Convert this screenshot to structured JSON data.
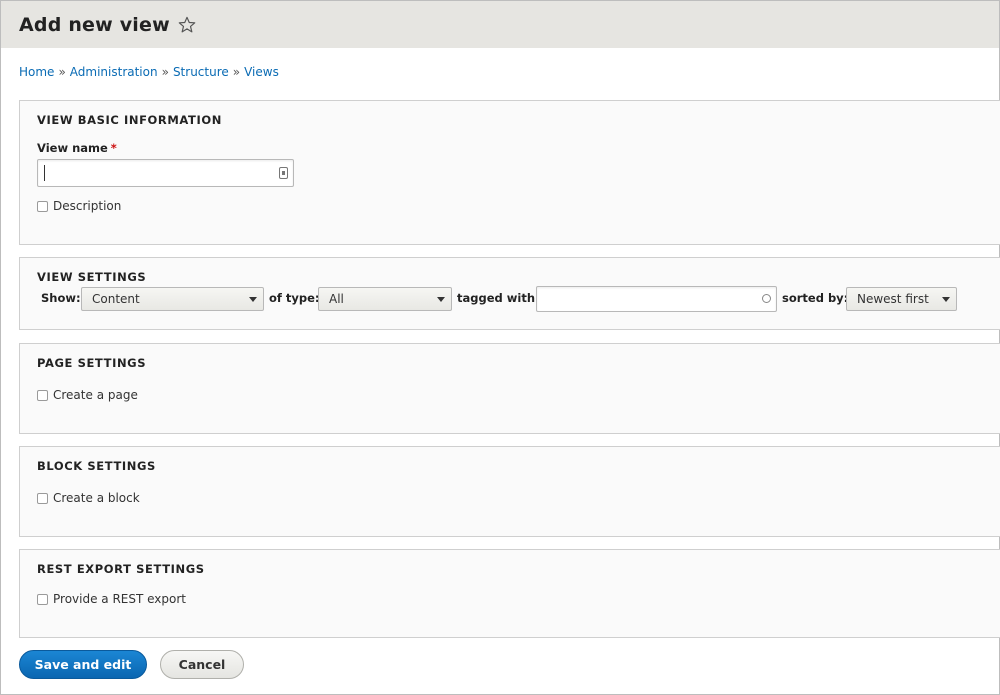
{
  "header": {
    "title": "Add new view",
    "favorite_icon": "star-outline-icon"
  },
  "breadcrumb": [
    "Home",
    "Administration",
    "Structure",
    "Views"
  ],
  "breadcrumb_separator": "»",
  "basic_info": {
    "legend": "VIEW BASIC INFORMATION",
    "view_name_label": "View name",
    "required_marker": "*",
    "view_name_value": "",
    "description_label": "Description"
  },
  "view_settings": {
    "legend": "VIEW SETTINGS",
    "show_label": "Show:",
    "show_value": "Content",
    "of_type_label": "of type:",
    "of_type_value": "All",
    "tagged_with_label": "tagged with:",
    "tagged_with_value": "",
    "sorted_by_label": "sorted by:",
    "sorted_by_value": "Newest first"
  },
  "page_settings": {
    "legend": "PAGE SETTINGS",
    "checkbox_label": "Create a page"
  },
  "block_settings": {
    "legend": "BLOCK SETTINGS",
    "checkbox_label": "Create a block"
  },
  "rest_settings": {
    "legend": "REST EXPORT SETTINGS",
    "checkbox_label": "Provide a REST export"
  },
  "actions": {
    "save_label": "Save and edit",
    "cancel_label": "Cancel"
  },
  "colors": {
    "primary": "#0a66b1",
    "link": "#0a6bb4",
    "required": "#cc1111",
    "header_bg": "#e6e5e1"
  }
}
